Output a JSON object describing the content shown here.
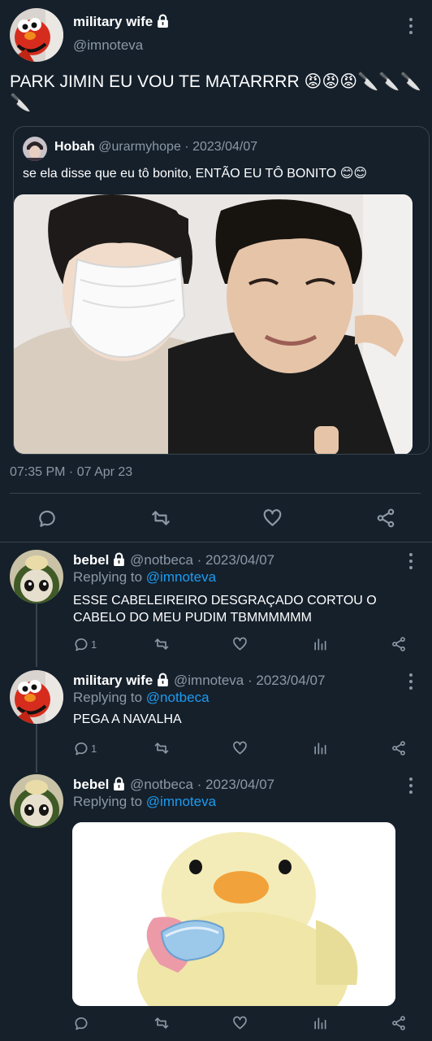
{
  "main_tweet": {
    "display_name": "military wife",
    "handle": "@imnoteva",
    "text": "PARK JIMIN EU VOU TE MATARRRR 😡😡😡🔪🔪🔪🔪",
    "timestamp": "07:35 PM · 07 Apr 23",
    "quoted": {
      "display_name": "Hobah",
      "handle": "@urarmyhope",
      "date": "· 2023/04/07",
      "text": "se ela disse que eu tô bonito, ENTÃO EU TÔ BONITO 😊😊"
    }
  },
  "replies": [
    {
      "display_name": "bebel",
      "handle": "@notbeca",
      "date": "· 2023/04/07",
      "replying_prefix": "Replying to",
      "replying_to": "@imnoteva",
      "text": "ESSE CABELEIREIRO DESGRAÇADO CORTOU O CABELO DO MEU PUDIM TBMMMMMM",
      "reply_count": "1"
    },
    {
      "display_name": "military wife",
      "handle": "@imnoteva",
      "date": "· 2023/04/07",
      "replying_prefix": "Replying to",
      "replying_to": "@notbeca",
      "text": "PEGA A NAVALHA",
      "reply_count": "1"
    },
    {
      "display_name": "bebel",
      "handle": "@notbeca",
      "date": "· 2023/04/07",
      "replying_prefix": "Replying to",
      "replying_to": "@imnoteva"
    }
  ],
  "colors": {
    "background": "#15202b",
    "muted": "#8b98a5",
    "link": "#1d9bf0",
    "divider": "#38444d"
  }
}
